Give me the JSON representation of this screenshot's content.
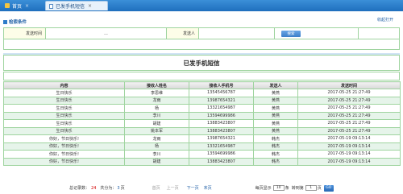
{
  "tabs": [
    {
      "label": "首页",
      "close": "×"
    },
    {
      "label": "已发手机短信",
      "close": "×"
    }
  ],
  "filter": {
    "title": "检索条件",
    "collapse_link": "收起打开",
    "send_time_label": "发送时间",
    "send_time_value": "...",
    "sender_label": "发送人",
    "sender_value": "",
    "search_button": "搜索"
  },
  "page_title": "已发手机短信",
  "table": {
    "headers": [
      "内容",
      "接收人姓名",
      "接收人手机号",
      "发送人",
      "发送时间"
    ],
    "rows": [
      [
        "生日快乐",
        "李思维",
        "13545456787",
        "黄燕",
        "2017-05-25 21:27:49"
      ],
      [
        "生日快乐",
        "龙雨",
        "13987654321",
        "黄燕",
        "2017-05-25 21:27:49"
      ],
      [
        "生日快乐",
        "杨",
        "13321654987",
        "黄燕",
        "2017-05-25 21:27:49"
      ],
      [
        "生日快乐",
        "李川",
        "13594699986",
        "黄燕",
        "2017-05-25 21:27:49"
      ],
      [
        "生日快乐",
        "胡建",
        "13883423807",
        "黄燕",
        "2017-05-25 21:27:49"
      ],
      [
        "生日快乐",
        "姚本军",
        "13883423807",
        "黄燕",
        "2017-05-25 21:27:49"
      ],
      [
        "你好，节日快乐!",
        "龙雨",
        "13987654321",
        "韩杰",
        "2017-05-19 09:13:14"
      ],
      [
        "你好，节日快乐!",
        "杨",
        "13321654987",
        "韩杰",
        "2017-05-19 09:13:14"
      ],
      [
        "你好，节日快乐!",
        "李川",
        "13594699986",
        "韩杰",
        "2017-05-19 09:13:14"
      ],
      [
        "你好，节日快乐!",
        "胡建",
        "13883423807",
        "韩杰",
        "2017-05-19 09:13:14"
      ]
    ]
  },
  "pager": {
    "total_label": "总记录数：",
    "total": "24",
    "pages_label": "共分为：",
    "pages": "3",
    "pages_unit": "页",
    "first": "首页",
    "prev": "上一页",
    "next": "下一页",
    "last": "末页",
    "per_page_label": "每页显示",
    "per_page": "10",
    "per_page_unit": "条",
    "goto_label": "转到第",
    "goto_value": "1",
    "goto_unit": "页",
    "go": "GO"
  },
  "colors": {
    "tabbar": "#1f6fbd",
    "table_border": "#9fd49f",
    "alt_row": "#e6f4ea",
    "link": "#1f5fa6",
    "count": "#d40000"
  }
}
